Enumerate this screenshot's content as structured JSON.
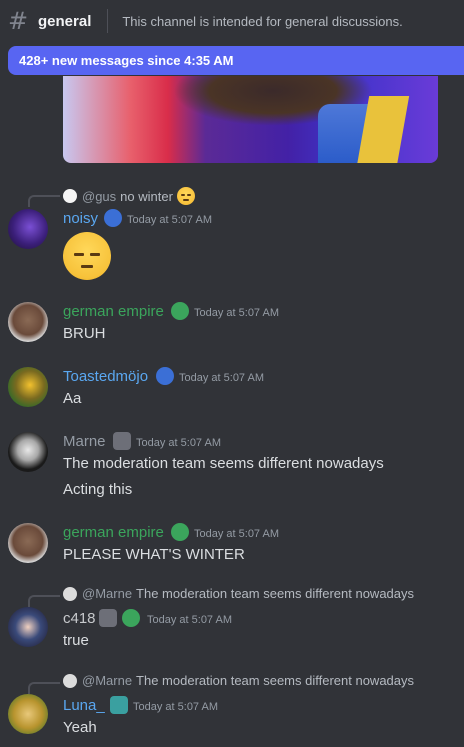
{
  "header": {
    "channel_name": "general",
    "topic": "This channel is intended for general discussions."
  },
  "new_messages_bar": {
    "label": "428+ new messages since 4:35 AM"
  },
  "messages": [
    {
      "reply_to_user": "@gus",
      "reply_text": "no winter",
      "username": "noisy",
      "username_color": "#5aa7f0",
      "timestamp": "Today at 5:07 AM",
      "content": "",
      "emoji": "pensive-face-emoji"
    },
    {
      "username": "german empire",
      "username_color": "#3ba55c",
      "timestamp": "Today at 5:07 AM",
      "content": "BRUH"
    },
    {
      "username": "Toastedmöjo",
      "username_color": "#5aa7f0",
      "timestamp": "Today at 5:07 AM",
      "content": "Aa"
    },
    {
      "username": "Marne",
      "username_color": "#949ba4",
      "timestamp": "Today at 5:07 AM",
      "content": "The moderation team seems different nowadays",
      "content2": "Acting this"
    },
    {
      "username": "german empire",
      "username_color": "#3ba55c",
      "timestamp": "Today at 5:07 AM",
      "content": "PLEASE WHAT'S WINTER"
    },
    {
      "reply_to_user": "@Marne",
      "reply_text": "The moderation team seems different nowadays",
      "username": "c418",
      "username_color": "#c7c9cc",
      "timestamp": "Today at 5:07 AM",
      "content": "true"
    },
    {
      "reply_to_user": "@Marne",
      "reply_text": "The moderation team seems different nowadays",
      "username": "Luna_",
      "username_color": "#5aa7f0",
      "timestamp": "Today at 5:07 AM",
      "content": "Yeah"
    }
  ],
  "colors": {
    "background": "#313338",
    "accent": "#5865f2",
    "timestamp": "#949ba4",
    "text": "#dbdee1"
  }
}
